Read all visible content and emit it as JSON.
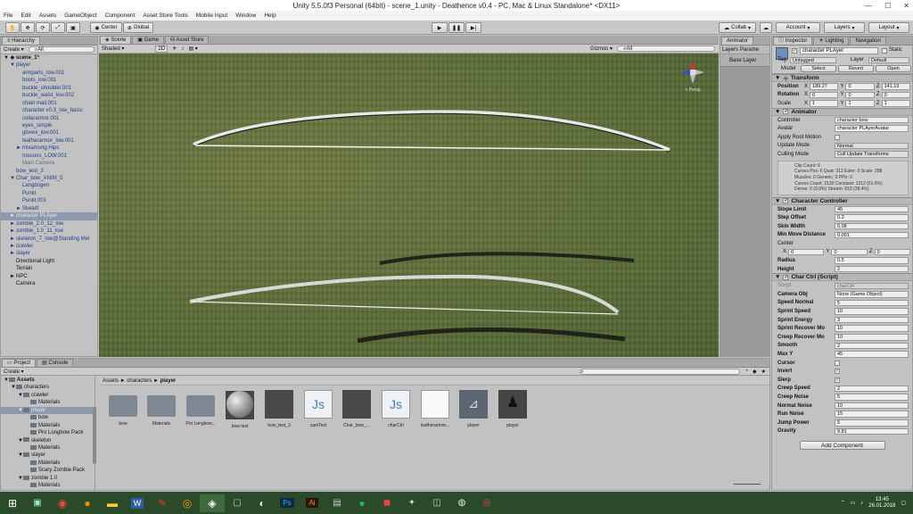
{
  "window": {
    "title": "Unity 5.5.0f3 Personal (64bit) - scene_1.unity - Deathence v0.4 - PC, Mac & Linux Standalone* <DX11>"
  },
  "menu": [
    "File",
    "Edit",
    "Assets",
    "GameObject",
    "Component",
    "Asset Store Tools",
    "Mobile Input",
    "Window",
    "Help"
  ],
  "toolbar": {
    "center": "Center",
    "global": "Global",
    "collab": "Collab",
    "account": "Account",
    "layers": "Layers",
    "layout": "Layout"
  },
  "hierarchy": {
    "tab": "Hierarchy",
    "create": "Create",
    "search": "All",
    "scene": "scene_1*",
    "items": [
      {
        "label": "player",
        "indent": 1,
        "blue": true,
        "arrow": "▼"
      },
      {
        "label": "armparts_low.001",
        "indent": 2,
        "blue": true
      },
      {
        "label": "boots_low.001",
        "indent": 2,
        "blue": true
      },
      {
        "label": "buckle_shoulder.001",
        "indent": 2,
        "blue": true
      },
      {
        "label": "buckle_waist_low.002",
        "indent": 2,
        "blue": true
      },
      {
        "label": "chain mail.001",
        "indent": 2,
        "blue": true
      },
      {
        "label": "character v0.3_low_basic",
        "indent": 2,
        "blue": true
      },
      {
        "label": "collararmor.001",
        "indent": 2,
        "blue": true
      },
      {
        "label": "eyes_simple",
        "indent": 2,
        "blue": true
      },
      {
        "label": "glovex_low.001",
        "indent": 2,
        "blue": true
      },
      {
        "label": "leatherarmor_low.001",
        "indent": 2,
        "blue": true
      },
      {
        "label": "mixamorig:Hips",
        "indent": 2,
        "blue": true,
        "arrow": "►"
      },
      {
        "label": "trousers_LOW.001",
        "indent": 2,
        "blue": true
      },
      {
        "label": "Main Camera",
        "indent": 2,
        "grey": true
      },
      {
        "label": "bow_test_3",
        "indent": 1,
        "blue": true
      },
      {
        "label": "Char_bow_ANIM_5",
        "indent": 1,
        "blue": true,
        "arrow": "▼"
      },
      {
        "label": "Langbogen",
        "indent": 2,
        "blue": true
      },
      {
        "label": "Punkt",
        "indent": 2,
        "blue": true
      },
      {
        "label": "Punkt.001",
        "indent": 2,
        "blue": true
      },
      {
        "label": "Skelett",
        "indent": 2,
        "blue": true,
        "arrow": "►"
      },
      {
        "label": "character PLAyer",
        "indent": 1,
        "selected": true,
        "arrow": "►"
      },
      {
        "label": "zombie_2.0_12_low",
        "indent": 1,
        "blue": true,
        "arrow": "►"
      },
      {
        "label": "zombie_1.0_11_low",
        "indent": 1,
        "blue": true,
        "arrow": "►"
      },
      {
        "label": "skeleton_7_low@Standing Mel",
        "indent": 1,
        "blue": true,
        "arrow": "►"
      },
      {
        "label": "crawler",
        "indent": 1,
        "blue": true,
        "arrow": "►"
      },
      {
        "label": "slayer",
        "indent": 1,
        "blue": true,
        "arrow": "►"
      },
      {
        "label": "Directional Light",
        "indent": 1
      },
      {
        "label": "Terrain",
        "indent": 1
      },
      {
        "label": "NPC",
        "indent": 1,
        "arrow": "►"
      },
      {
        "label": "Camera",
        "indent": 1
      }
    ]
  },
  "scene": {
    "tabs": [
      "Scene",
      "Game",
      "Asset Store"
    ],
    "shaded": "Shaded",
    "mode2d": "2D",
    "gizmos": "Gizmos",
    "search": "All",
    "persp": "< Persp"
  },
  "animator": {
    "tab": "Animator",
    "param": "Parame",
    "layers": "Layers",
    "base": "Base Layer"
  },
  "inspector": {
    "tabs": [
      "Inspector",
      "Lighting",
      "Navigation"
    ],
    "name": "character PLAyer",
    "static": "Static",
    "tag": "Untagged",
    "layer": "Default",
    "model": "Model",
    "select": "Select",
    "revert": "Revert",
    "open": "Open",
    "transform": {
      "title": "Transform",
      "position": [
        "189.27",
        "0",
        "141.19"
      ],
      "rotation": [
        "0",
        "0",
        "0"
      ],
      "scale": [
        "1",
        "1",
        "1"
      ]
    },
    "animator": {
      "title": "Animator",
      "controller": "character bow",
      "avatar": "character PLAyerAvatar",
      "update": "Normal",
      "culling": "Cull Update Transforms",
      "info": [
        "Clip Count: 6",
        "Curves Pos: 6 Quat: 312 Euler: 0 Scale: 288",
        "Muscles: 0 Generic: 0 PPtr: 0",
        "Curves Count: 2130 Constant: 1312 (61.6%)",
        "Dense: 0 (0.0%) Stream: 818 (38.4%)"
      ]
    },
    "cc": {
      "title": "Character Controller",
      "rows": [
        [
          "Slope Limit",
          "45"
        ],
        [
          "Step Offset",
          "0.3"
        ],
        [
          "Skin Width",
          "0.08"
        ],
        [
          "Min Move Distance",
          "0.001"
        ]
      ],
      "center": [
        "0",
        "0",
        "0"
      ],
      "radius": "0.5",
      "height": "2"
    },
    "charctrl": {
      "title": "Char Ctrl (Script)",
      "script": "charCtrl",
      "cameraobj": "None (Game Object)",
      "rows": [
        [
          "Speed Normal",
          "5"
        ],
        [
          "Sprint Speed",
          "10"
        ],
        [
          "Sprint Energy",
          "3"
        ],
        [
          "Sprint Recover Mo",
          "10"
        ],
        [
          "Creep Recover Mo",
          "10"
        ],
        [
          "Smooth",
          "2"
        ],
        [
          "Max Y",
          "45"
        ]
      ],
      "checks": [
        [
          "Cursor",
          false
        ],
        [
          "Invert",
          true
        ],
        [
          "Slerp",
          true
        ]
      ],
      "rows2": [
        [
          "Creep Speed",
          "2"
        ],
        [
          "Creep Noise",
          "5"
        ],
        [
          "Normal Noise",
          "10"
        ],
        [
          "Run Noise",
          "15"
        ],
        [
          "Jump Power",
          "5"
        ],
        [
          "Gravity",
          "9.81"
        ]
      ]
    },
    "add": "Add Component"
  },
  "project": {
    "tabs": [
      "Project",
      "Console"
    ],
    "create": "Create",
    "breadcrumb": [
      "Assets",
      "characters",
      "player"
    ],
    "tree": [
      {
        "label": "Assets",
        "indent": 0,
        "arrow": "▼",
        "bold": true
      },
      {
        "label": "characters",
        "indent": 1,
        "arrow": "▼"
      },
      {
        "label": "crawler",
        "indent": 2,
        "arrow": "▼"
      },
      {
        "label": "Materials",
        "indent": 3
      },
      {
        "label": "player",
        "indent": 2,
        "arrow": "▼",
        "selected": true
      },
      {
        "label": "bow",
        "indent": 3
      },
      {
        "label": "Materials",
        "indent": 3
      },
      {
        "label": "Pro Longbow Pack",
        "indent": 3
      },
      {
        "label": "skeleton",
        "indent": 2,
        "arrow": "▼"
      },
      {
        "label": "Materials",
        "indent": 3
      },
      {
        "label": "slayer",
        "indent": 2,
        "arrow": "▼"
      },
      {
        "label": "Materials",
        "indent": 3
      },
      {
        "label": "Scary Zombie Pack",
        "indent": 3
      },
      {
        "label": "zombie 1.0",
        "indent": 2,
        "arrow": "▼"
      },
      {
        "label": "Materials",
        "indent": 3
      }
    ],
    "assets": [
      "bow",
      "Materials",
      "Pro Longbow...",
      "bow test",
      "bow_test_3",
      "camTest",
      "Char_bow_...",
      "charCtrl",
      "leatherarmor...",
      "player",
      "player"
    ]
  },
  "taskbar": {
    "time": "13:45",
    "date": "26.01.2018"
  }
}
